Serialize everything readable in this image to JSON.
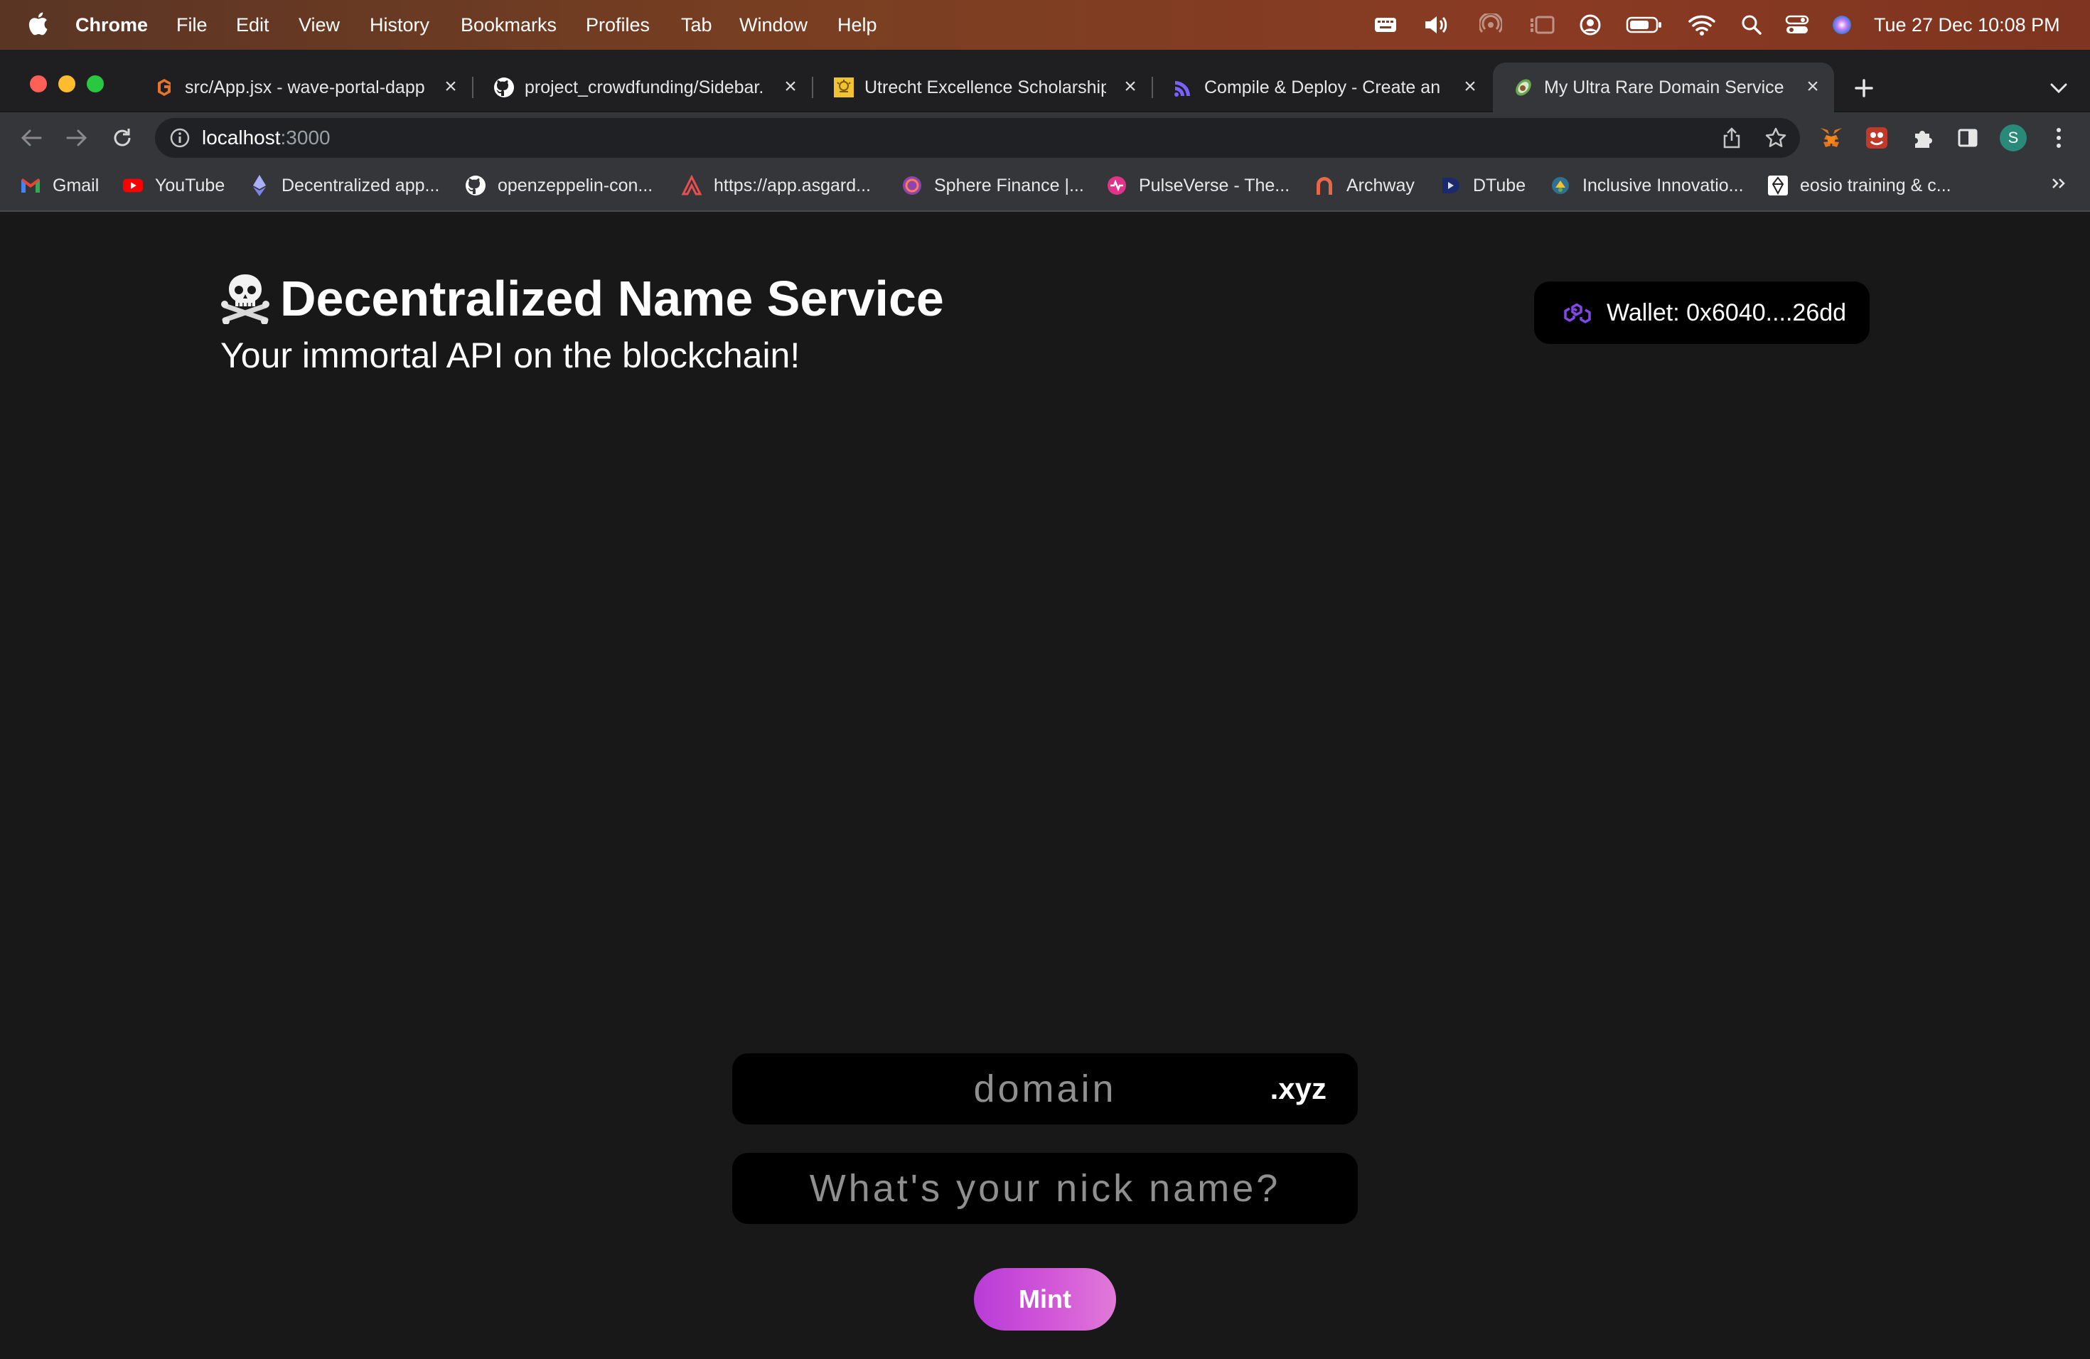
{
  "menubar": {
    "app_name": "Chrome",
    "items": [
      "File",
      "Edit",
      "View",
      "History",
      "Bookmarks",
      "Profiles",
      "Tab",
      "Window",
      "Help"
    ],
    "datetime": "Tue 27 Dec  10:08 PM"
  },
  "tabs": [
    {
      "title": "src/App.jsx - wave-portal-dapp",
      "favicon": "gitpod-icon",
      "color": "#e8742c"
    },
    {
      "title": "project_crowdfunding/Sidebar.",
      "favicon": "github-icon",
      "color": "#ffffff"
    },
    {
      "title": "Utrecht Excellence Scholarship",
      "favicon": "university-icon",
      "color": "#f1c232"
    },
    {
      "title": "Compile & Deploy - Create an N",
      "favicon": "alchemy-icon",
      "color": "#7b61ff"
    },
    {
      "title": "My Ultra Rare Domain Service",
      "favicon": "avocado-icon",
      "color": "#6aa84f"
    }
  ],
  "toolbar": {
    "url_host": "localhost",
    "url_port": ":3000",
    "profile_initial": "S"
  },
  "bookmarks": [
    {
      "label": "Gmail",
      "icon": "gmail-icon"
    },
    {
      "label": "YouTube",
      "icon": "youtube-icon"
    },
    {
      "label": "Decentralized app...",
      "icon": "ethereum-icon"
    },
    {
      "label": "openzeppelin-con...",
      "icon": "github-icon"
    },
    {
      "label": "https://app.asgard...",
      "icon": "asgard-icon"
    },
    {
      "label": "Sphere Finance |...",
      "icon": "sphere-icon"
    },
    {
      "label": "PulseVerse - The...",
      "icon": "pulse-icon"
    },
    {
      "label": "Archway",
      "icon": "archway-icon"
    },
    {
      "label": "DTube",
      "icon": "dtube-icon"
    },
    {
      "label": "Inclusive Innovatio...",
      "icon": "inclusive-icon"
    },
    {
      "label": "eosio training & c...",
      "icon": "eos-icon"
    }
  ],
  "app": {
    "title": "Decentralized Name Service",
    "subtitle": "Your immortal API on the blockchain!",
    "wallet_label": "Wallet: 0x6040....26dd",
    "domain_placeholder": "domain",
    "tld": ".xyz",
    "nickname_placeholder": "What's your nick name?",
    "mint_label": "Mint"
  },
  "colors": {
    "page_bg": "#181818",
    "mint_gradient_start": "#b93bd8",
    "mint_gradient_end": "#e07ad8",
    "polygon_purple": "#8247e5"
  }
}
